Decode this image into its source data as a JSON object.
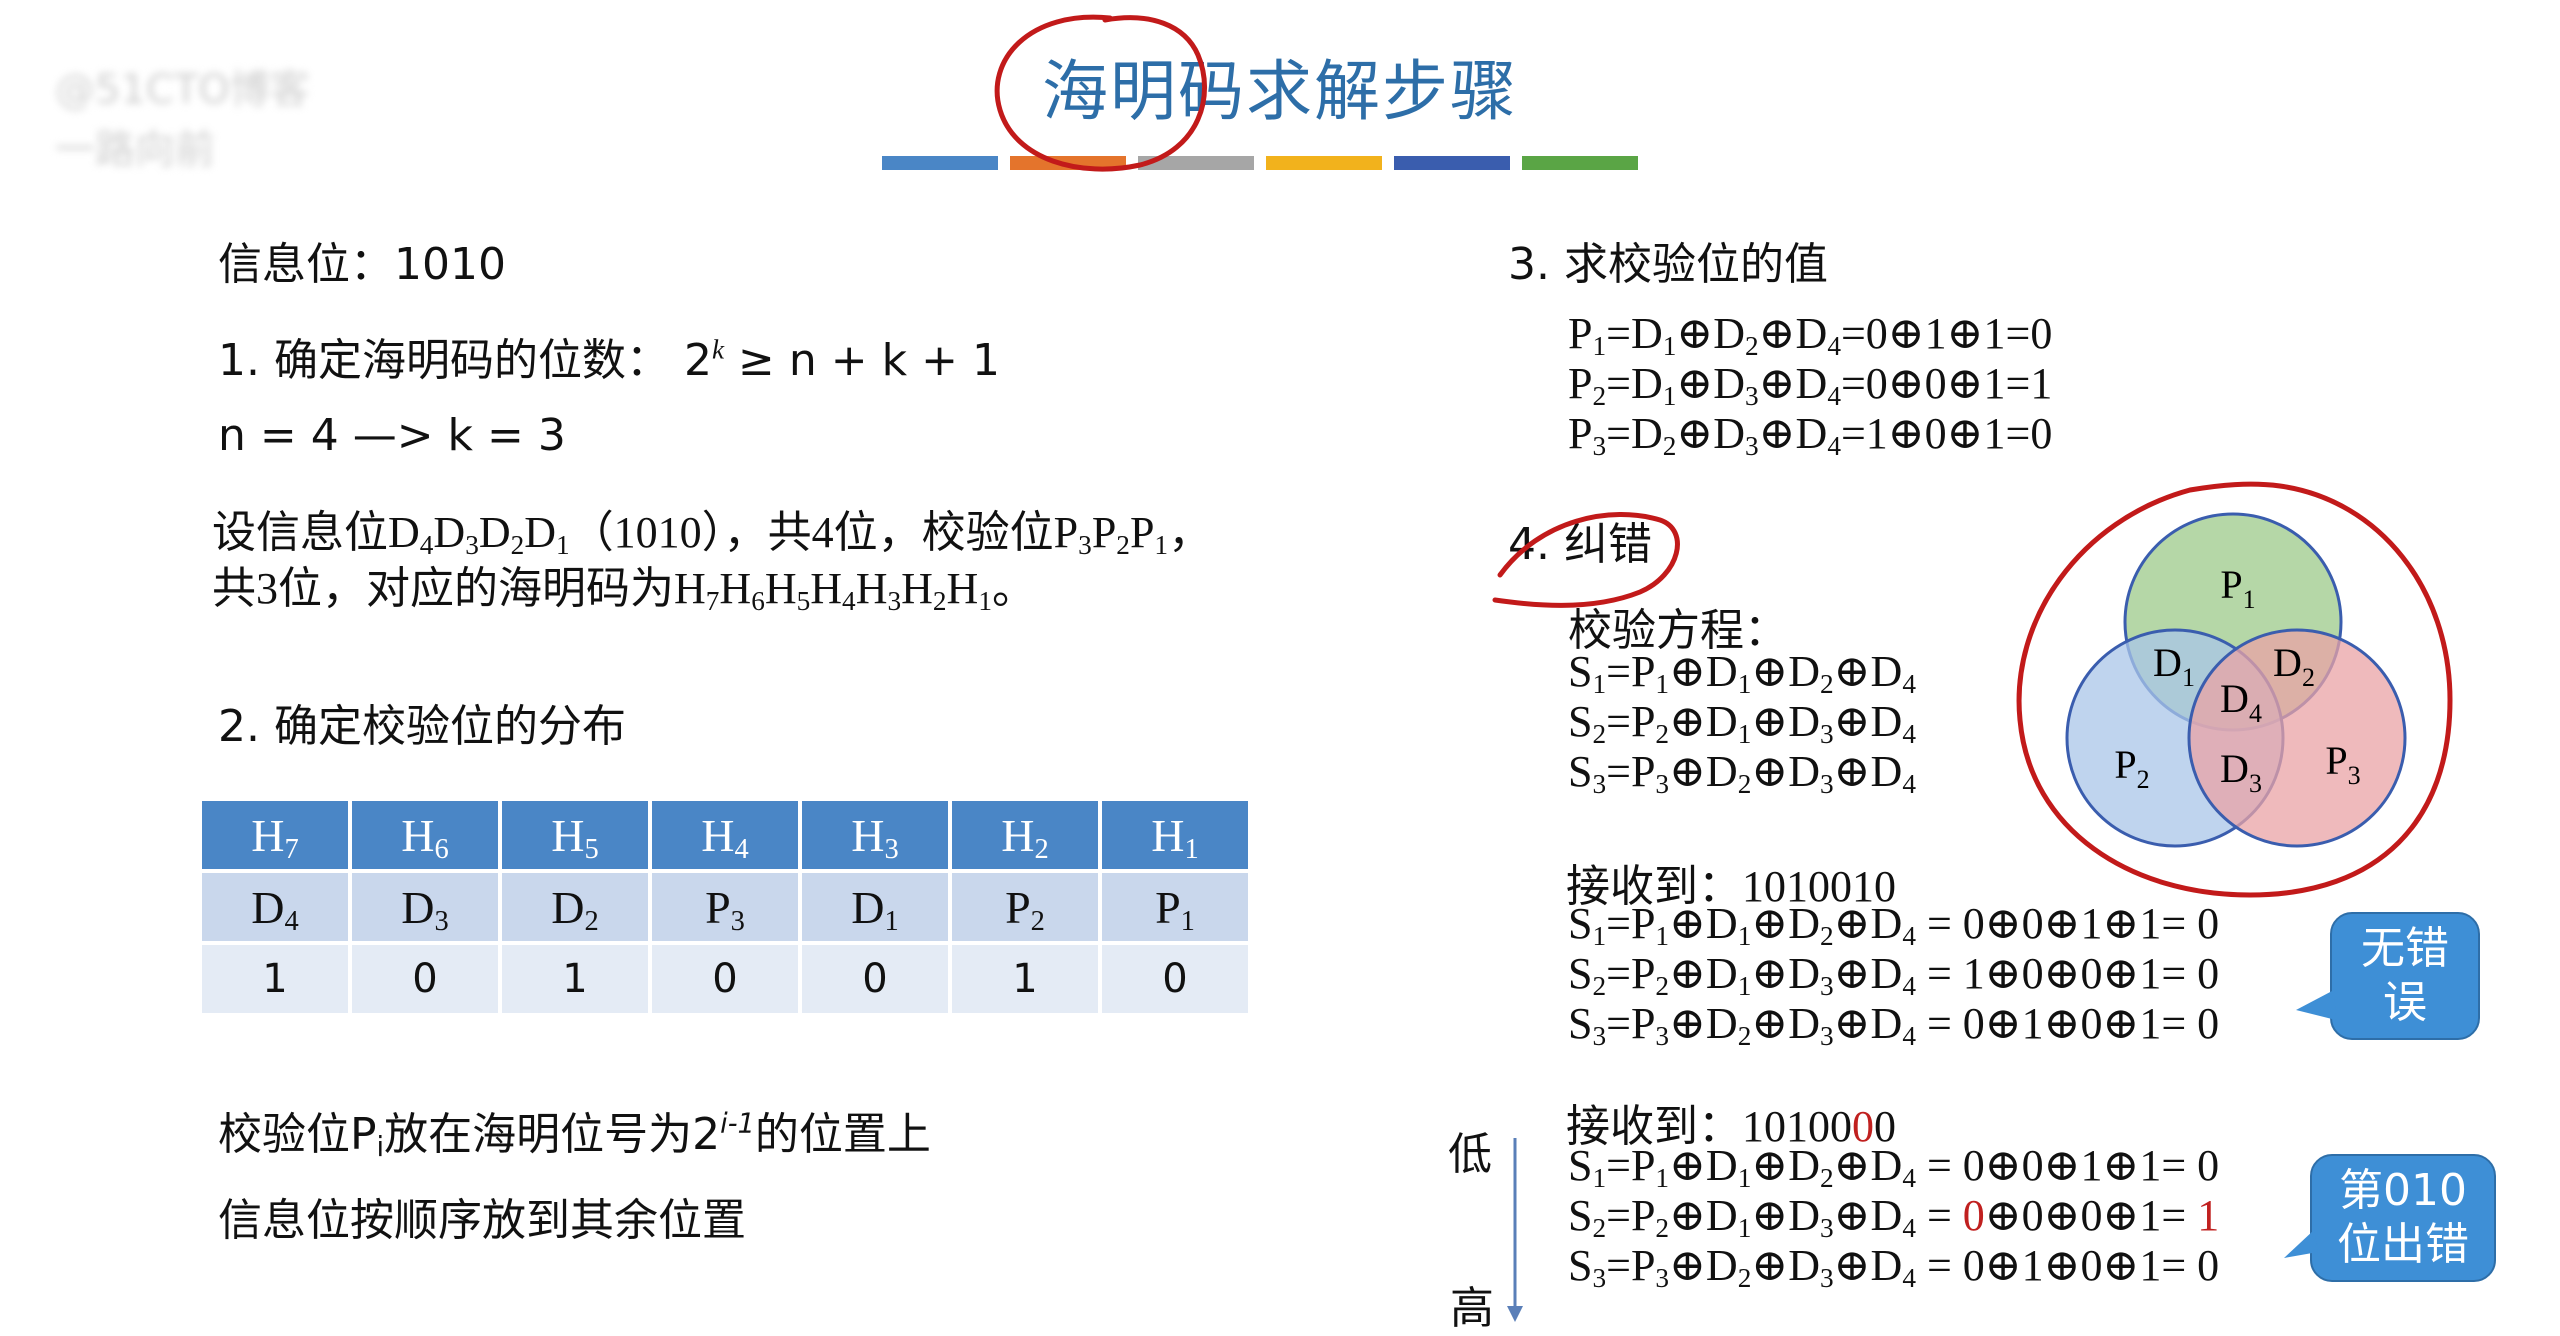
{
  "watermark": {
    "line1": "@51CTO博客",
    "line2": "一路向前"
  },
  "title": "海明码求解步骤",
  "title_bar_colors": [
    "#4a86c6",
    "#e4742c",
    "#a6a6a6",
    "#f2b21c",
    "#3a5dae",
    "#5aa545"
  ],
  "left": {
    "info_bits": "信息位：1010",
    "step1_prefix": "1.  确定海明码的位数：  2",
    "step1_sup": "k",
    "step1_suffix": " ≥ n + k + 1",
    "n_k": "n = 4    —>    k = 3",
    "desc1": "设信息位D",
    "desc_line2": "共3位，对应的海明码为H",
    "step2": "2.  确定校验位的分布",
    "note1_a": "校验位P",
    "note1_sub": "i",
    "note1_b": "放在海明位号为2",
    "note1_sup": "i-1",
    "note1_c": "的位置上",
    "note2": "信息位按顺序放到其余位置"
  },
  "table": {
    "header": [
      "H7",
      "H6",
      "H5",
      "H4",
      "H3",
      "H2",
      "H1"
    ],
    "roles": [
      "D4",
      "D3",
      "D2",
      "P3",
      "D1",
      "P2",
      "P1"
    ],
    "bits": [
      "1",
      "0",
      "1",
      "0",
      "0",
      "1",
      "0"
    ]
  },
  "right": {
    "step3": "3.  求校验位的值",
    "p1": "=0⊕1⊕1=0",
    "p2": "=0⊕0⊕1=1",
    "p3": "=1⊕0⊕1=0",
    "step4": "4.  纠错",
    "check_eq": "校验方程：",
    "recv1": "接收到：1010010",
    "recv1_s1": "= 0⊕0⊕1⊕1= 0",
    "recv1_s2": "= 1⊕0⊕0⊕1= 0",
    "recv1_s3": "= 0⊕1⊕0⊕1= 0",
    "recv2_prefix": "接收到：10100",
    "recv2_red": "0",
    "recv2_suffix": "0",
    "recv2_s1": "= 0⊕0⊕1⊕1= 0",
    "recv2_s2_red0": "0",
    "recv2_s2_mid": "⊕0⊕0⊕1= ",
    "recv2_s2_red1": "1",
    "recv2_s3": "= 0⊕1⊕0⊕1= 0",
    "low": "低",
    "high": "高",
    "callout1": [
      "无错",
      "误"
    ],
    "callout2": [
      "第010",
      "位出错"
    ]
  },
  "venn": {
    "labels": [
      "P1",
      "P2",
      "P3",
      "D1",
      "D2",
      "D3",
      "D4"
    ],
    "colors": {
      "p1": "#9cc98a",
      "p2": "#a9c6e8",
      "p3": "#eaa3a6"
    }
  },
  "annotation_color": "#c21a1a"
}
